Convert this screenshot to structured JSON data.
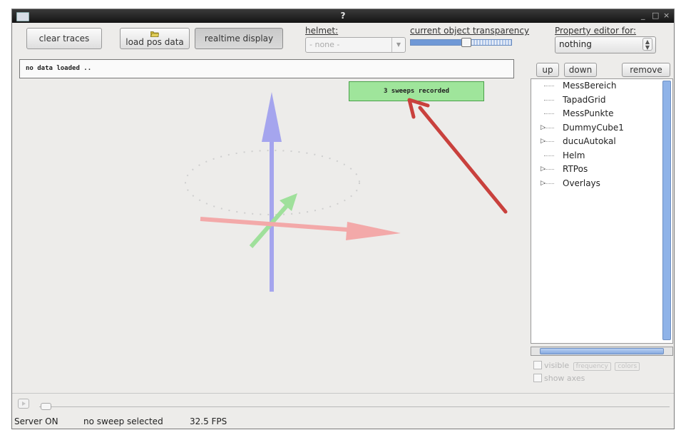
{
  "window": {
    "title": "?",
    "minimize_glyph": "_",
    "maximize_glyph": "□",
    "close_glyph": "×"
  },
  "toolbar": {
    "clear_traces_label": "clear traces",
    "load_pos_data_label": "load pos data",
    "realtime_display_label": "realtime display",
    "helmet_label": "helmet:",
    "helmet_value": "- none -",
    "transparency_label": "current object transparency",
    "transparency_value": 0.55,
    "property_editor_label": "Property editor for:",
    "property_editor_value": "nothing"
  },
  "viewport": {
    "info_text": "no data loaded ..",
    "sweeps_text": "3 sweeps recorded"
  },
  "side_panel": {
    "up_label": "up",
    "down_label": "down",
    "remove_label": "remove",
    "tree": [
      {
        "label": "MessBereich",
        "expandable": false
      },
      {
        "label": "TapadGrid",
        "expandable": false
      },
      {
        "label": "MessPunkte",
        "expandable": false
      },
      {
        "label": "DummyCube1",
        "expandable": true
      },
      {
        "label": "ducuAutokal",
        "expandable": true
      },
      {
        "label": "Helm",
        "expandable": false
      },
      {
        "label": "RTPos",
        "expandable": true
      },
      {
        "label": "Overlays",
        "expandable": true
      }
    ],
    "visible_label": "visible",
    "btn_a_label": "frequency",
    "btn_b_label": "colors",
    "show_axes_label": "show axes"
  },
  "status_bar": {
    "server": "Server ON",
    "sweep": "no sweep selected",
    "fps": "32.5 FPS"
  }
}
